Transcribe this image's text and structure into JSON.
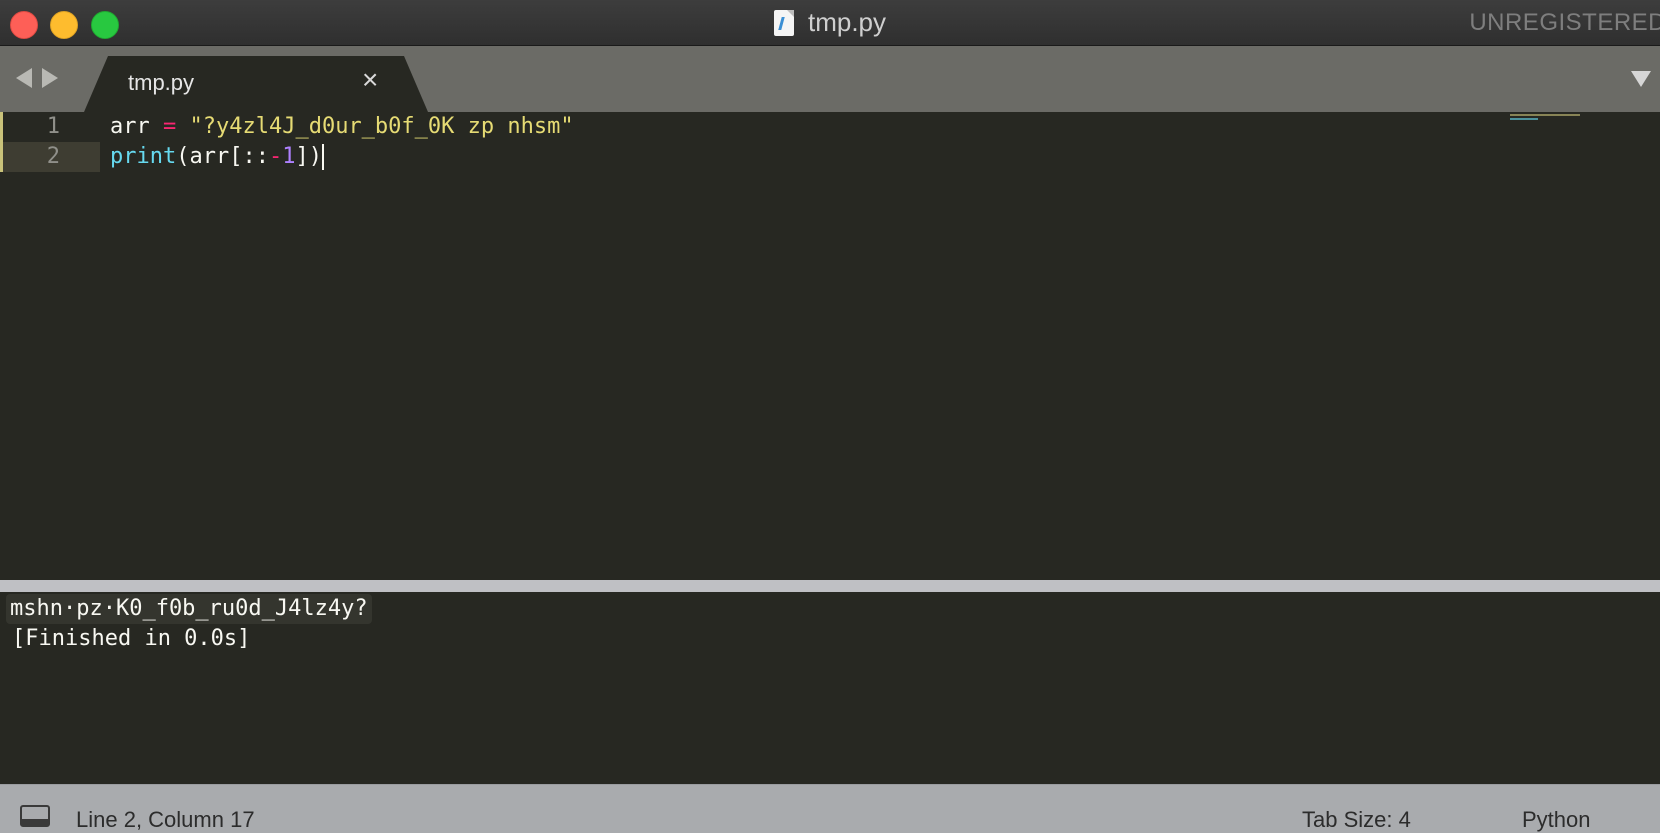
{
  "window": {
    "title": "tmp.py",
    "license_label": "UNREGISTERED"
  },
  "tabs": [
    {
      "label": "tmp.py",
      "close_glyph": "×"
    }
  ],
  "editor": {
    "lines": [
      {
        "number": "1",
        "tokens": {
          "var": "arr",
          "sp1": " ",
          "op": "=",
          "sp2": " ",
          "str": "\"?y4zl4J_d0ur_b0f_0K zp nhsm\""
        }
      },
      {
        "number": "2",
        "tokens": {
          "fn": "print",
          "open": "(",
          "arg": "arr[::",
          "minus": "-",
          "num": "1",
          "close": "])"
        }
      }
    ]
  },
  "output": {
    "lines": [
      "mshn·pz·K0_f0b_ru0d_J4lz4y?",
      "[Finished in 0.0s]"
    ]
  },
  "status_bar": {
    "position": "Line 2, Column 17",
    "tab_size": "Tab Size: 4",
    "syntax": "Python"
  },
  "icons": {
    "close": "close-window-icon",
    "minimize": "minimize-window-icon",
    "maximize": "maximize-window-icon",
    "file": "python-file-icon",
    "back": "arrow-left-icon",
    "forward": "arrow-right-icon",
    "tab_close": "close-icon",
    "dropdown": "chevron-down-icon",
    "panel": "panel-toggle-icon"
  },
  "colors": {
    "keyword_operator": "#f92672",
    "string": "#e6db74",
    "function": "#66d9ef",
    "number": "#ae81ff",
    "background": "#272822"
  }
}
